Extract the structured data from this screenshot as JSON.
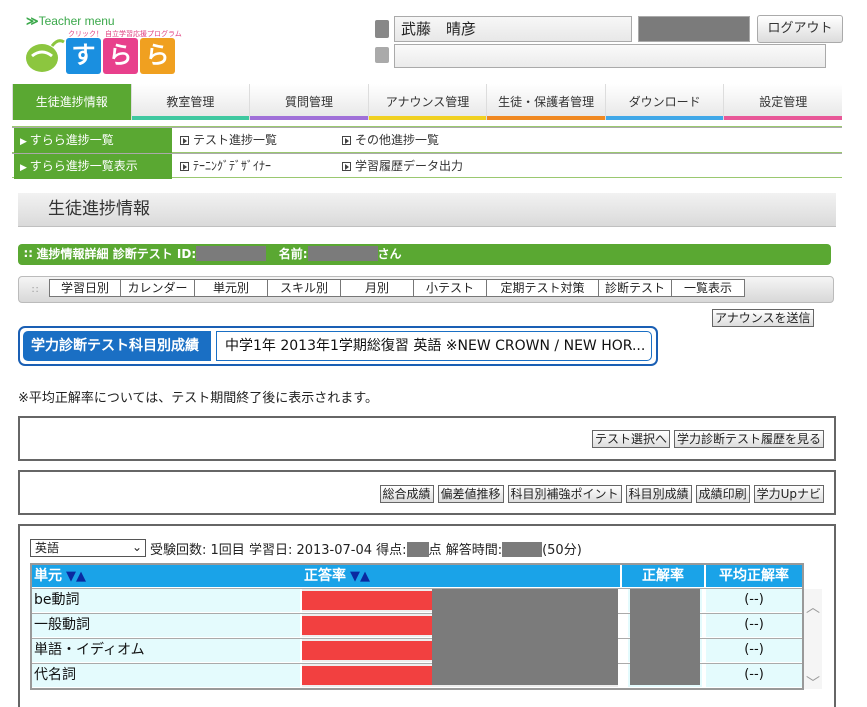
{
  "header": {
    "logo_top": "Teacher menu",
    "logo_sub": "クリック！ 自立学習応援プログラム",
    "logo_tiles": [
      "す",
      "ら",
      "ら"
    ],
    "logo_colors": [
      "#1a8fe0",
      "#e8408c",
      "#f0a020"
    ],
    "user_name": "武藤　晴彦",
    "logout_label": "ログアウト"
  },
  "main_nav": [
    {
      "label": "生徒進捗情報",
      "color": "#5aa832",
      "active": true
    },
    {
      "label": "教室管理",
      "color": "#3fc8a0",
      "active": false
    },
    {
      "label": "質問管理",
      "color": "#a070d8",
      "active": false
    },
    {
      "label": "アナウンス管理",
      "color": "#f0d020",
      "active": false
    },
    {
      "label": "生徒・保護者管理",
      "color": "#f08820",
      "active": false
    },
    {
      "label": "ダウンロード",
      "color": "#40a8e8",
      "active": false
    },
    {
      "label": "設定管理",
      "color": "#e85898",
      "active": false
    }
  ],
  "sub_nav": {
    "row1": [
      "すらら進捗一覧",
      "テスト進捗一覧",
      "その他進捗一覧"
    ],
    "row2": [
      "すらら進捗一覧表示",
      "ﾃｰﾆﾝｸﾞﾃﾞｻﾞｲﾅｰ",
      "学習履歴データ出力"
    ]
  },
  "page_title": "生徒進捗情報",
  "detail": {
    "label": "進捗情報詳細 診断テスト ID:",
    "name_label": "名前:",
    "san": "さん"
  },
  "view_tabs": [
    "学習日別",
    "カレンダー",
    "単元別",
    "スキル別",
    "月別",
    "小テスト",
    "定期テスト対策",
    "診断テスト",
    "一覧表示"
  ],
  "announce_button": "アナウンスを送信",
  "subject": {
    "label": "学力診断テスト科目別成績",
    "value": "中学1年  2013年1学期総復習 英語 ※NEW CROWN / NEW HOR..."
  },
  "note": "※平均正解率については、テスト期間終了後に表示されます。",
  "panel1_buttons": [
    "テスト選択へ",
    "学力診断テスト履歴を見る"
  ],
  "panel2_buttons": [
    "総合成績",
    "偏差値推移",
    "科目別補強ポイント",
    "科目別成績",
    "成績印刷",
    "学力Upナビ"
  ],
  "exam": {
    "subject_select": "英語",
    "count": "受験回数: 1回目",
    "date": "学習日: 2013-07-04",
    "score": "得点:",
    "score_unit": "点",
    "time": "解答時間:",
    "time_limit": "(50分)"
  },
  "table": {
    "headers": [
      "単元",
      "正答率",
      "正解率",
      "平均正解率"
    ],
    "sort_arrows": "▼▲",
    "rows": [
      {
        "unit": "be動詞",
        "avg": "(--)"
      },
      {
        "unit": "一般動詞",
        "avg": "(--)"
      },
      {
        "unit": "単語・イディオム",
        "avg": "(--)"
      },
      {
        "unit": "代名詞",
        "avg": "(--)"
      }
    ]
  },
  "colors": {
    "accent_green": "#5aa832",
    "header_blue": "#1aa3e8",
    "bar_red": "#f24040"
  }
}
